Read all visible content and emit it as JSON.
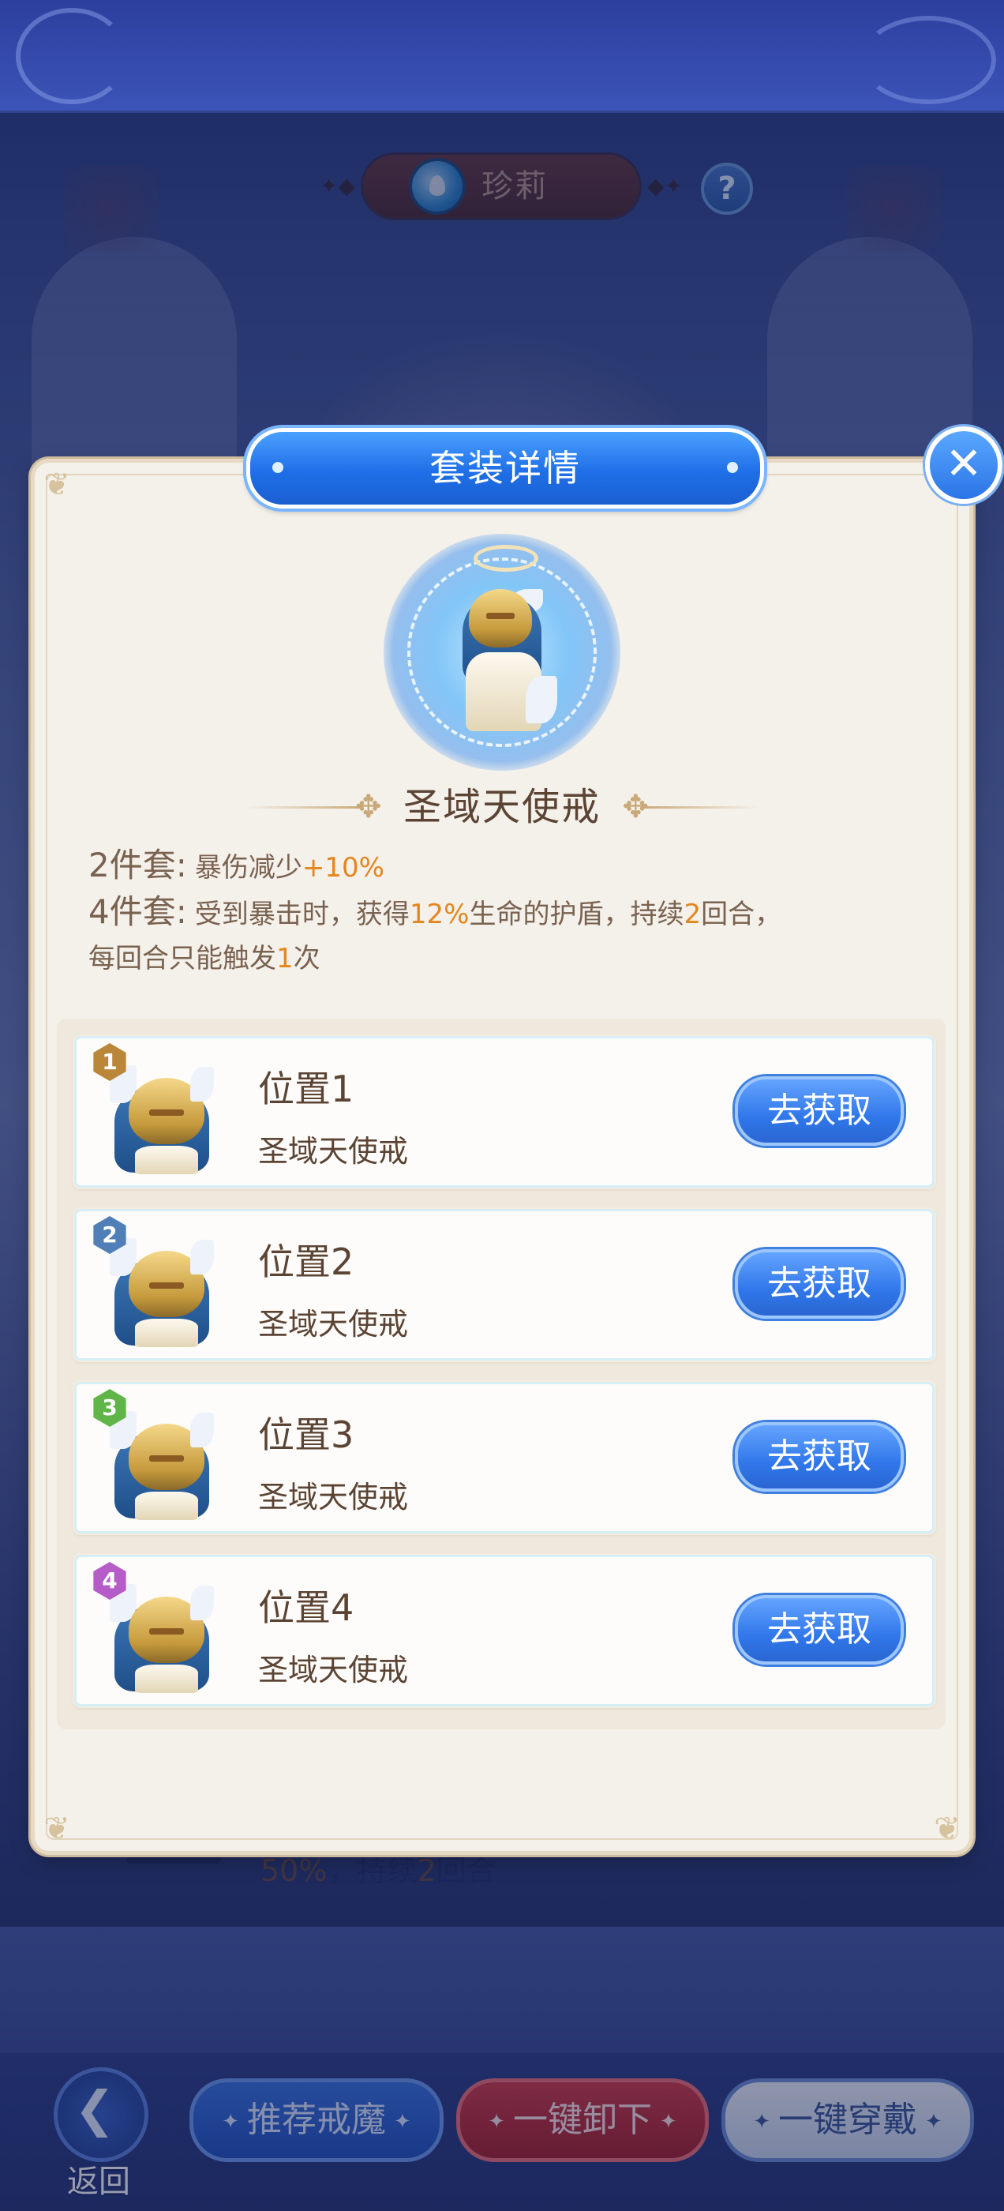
{
  "header": {
    "character_name": "珍莉",
    "help_icon": "question-mark-icon",
    "element_icon": "water-element-icon"
  },
  "modal": {
    "title": "套装详情",
    "close_icon": "close-icon",
    "set_name": "圣域天使戒",
    "effects": [
      {
        "key": "2件套:",
        "parts": [
          {
            "t": "暴伤减少"
          },
          {
            "t": "+10%",
            "hl": true
          }
        ]
      },
      {
        "key": "4件套:",
        "parts": [
          {
            "t": "受到暴击时，获得"
          },
          {
            "t": "12%",
            "hl": true
          },
          {
            "t": "生命的护盾，持续"
          },
          {
            "t": "2",
            "hl": true
          },
          {
            "t": "回合，"
          }
        ]
      },
      {
        "key": "",
        "parts": [
          {
            "t": "每回合只能触发"
          },
          {
            "t": "1",
            "hl": true
          },
          {
            "t": "次"
          }
        ]
      }
    ],
    "slots": [
      {
        "badge": "1",
        "badge_color": "#b9863a",
        "title": "位置1",
        "name": "圣域天使戒",
        "button": "去获取"
      },
      {
        "badge": "2",
        "badge_color": "#4f7fb6",
        "title": "位置2",
        "name": "圣域天使戒",
        "button": "去获取"
      },
      {
        "badge": "3",
        "badge_color": "#5fb548",
        "title": "位置3",
        "name": "圣域天使戒",
        "button": "去获取"
      },
      {
        "badge": "4",
        "badge_color": "#b65cc8",
        "title": "位置4",
        "name": "圣域天使戒",
        "button": "去获取"
      }
    ]
  },
  "background_text": {
    "value": "50%",
    "rest": "，持续",
    "turns": "2",
    "suffix": "回合"
  },
  "bottom": {
    "back_label": "返回",
    "recommend_label": "推荐戒魔",
    "unequip_label": "一键卸下",
    "equip_label": "一键穿戴"
  },
  "colors": {
    "accent_blue": "#2b74e6",
    "highlight_orange": "#e4861e",
    "text_brown": "#5c4434"
  }
}
